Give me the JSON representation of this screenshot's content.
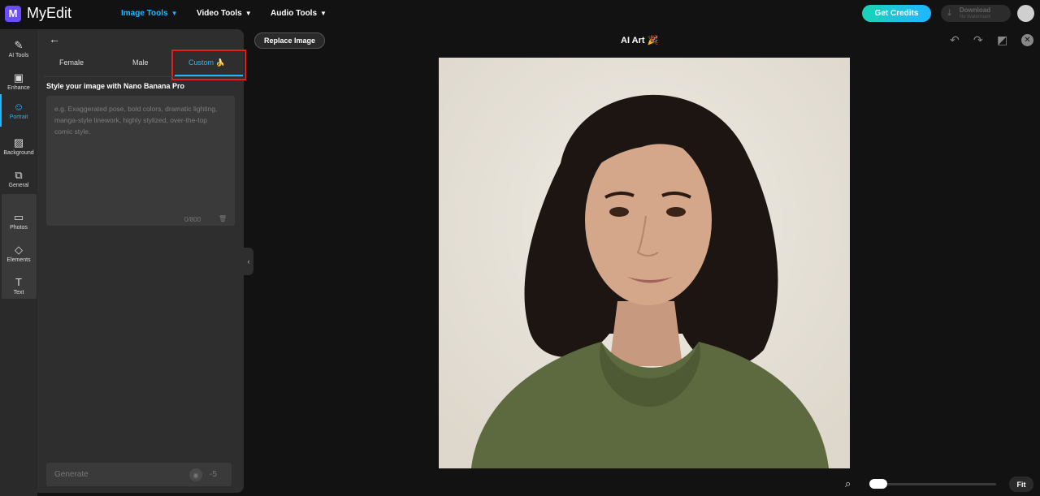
{
  "app": {
    "logo_mark": "M",
    "name": "MyEdit"
  },
  "nav": {
    "image_tools": "Image Tools",
    "video_tools": "Video Tools",
    "audio_tools": "Audio Tools"
  },
  "header": {
    "get_credits": "Get Credits",
    "download": "Download",
    "download_sub": "No Watermark"
  },
  "sidebar": {
    "items": [
      {
        "label": "AI Tools",
        "icon": "magic-wand-icon"
      },
      {
        "label": "Enhance",
        "icon": "enhance-image-icon"
      },
      {
        "label": "Portrait",
        "icon": "portrait-icon",
        "active": true
      },
      {
        "label": "Background",
        "icon": "background-icon"
      },
      {
        "label": "General",
        "icon": "general-icon"
      },
      {
        "label": "Photos",
        "icon": "photos-icon"
      },
      {
        "label": "Elements",
        "icon": "elements-icon"
      },
      {
        "label": "Text",
        "icon": "text-icon"
      }
    ]
  },
  "panel": {
    "tabs": [
      {
        "label": "Female"
      },
      {
        "label": "Male"
      },
      {
        "label": "Custom 🍌",
        "active": true
      }
    ],
    "prompt_title": "Style your image with Nano Banana Pro",
    "prompt_placeholder": "e.g. Exaggerated pose, bold colors, dramatic lighting, manga-style linework, highly stylized, over-the-top comic style.",
    "char_count": "0/800",
    "generate": "Generate",
    "cost": "-5"
  },
  "canvas": {
    "replace_image": "Replace Image",
    "title": "AI Art 🎉",
    "fit": "Fit",
    "zoom_level": 0.1
  },
  "colors": {
    "accent": "#1fb7ff",
    "brand": "#6b4cff",
    "highlight": "#e01e1e"
  }
}
